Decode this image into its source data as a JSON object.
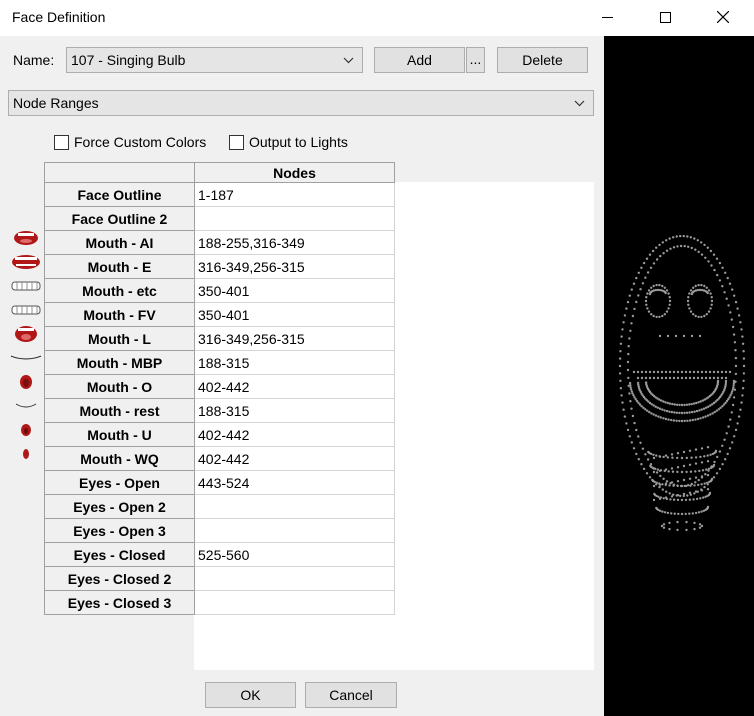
{
  "window": {
    "title": "Face Definition",
    "min_icon": "minimize-icon",
    "max_icon": "maximize-icon",
    "close_icon": "close-icon"
  },
  "name_row": {
    "label": "Name:",
    "selected": "107 - Singing Bulb",
    "add_label": "Add",
    "more_label": "...",
    "delete_label": "Delete"
  },
  "mode_combo": {
    "selected": "Node Ranges"
  },
  "options": {
    "force_custom_colors": {
      "label": "Force Custom Colors",
      "checked": false
    },
    "output_to_lights": {
      "label": "Output to Lights",
      "checked": false
    }
  },
  "grid": {
    "column_header": "Nodes",
    "rows": [
      {
        "name": "Face Outline",
        "nodes": "1-187",
        "icon": ""
      },
      {
        "name": "Face Outline 2",
        "nodes": "",
        "icon": ""
      },
      {
        "name": "Mouth - AI",
        "nodes": "188-255,316-349",
        "icon": "mouth-ai-icon"
      },
      {
        "name": "Mouth - E",
        "nodes": "316-349,256-315",
        "icon": "mouth-e-icon"
      },
      {
        "name": "Mouth - etc",
        "nodes": "350-401",
        "icon": "mouth-etc-icon"
      },
      {
        "name": "Mouth - FV",
        "nodes": "350-401",
        "icon": "mouth-fv-icon"
      },
      {
        "name": "Mouth - L",
        "nodes": "316-349,256-315",
        "icon": "mouth-l-icon"
      },
      {
        "name": "Mouth - MBP",
        "nodes": "188-315",
        "icon": "mouth-mbp-icon"
      },
      {
        "name": "Mouth - O",
        "nodes": "402-442",
        "icon": "mouth-o-icon"
      },
      {
        "name": "Mouth - rest",
        "nodes": "188-315",
        "icon": "mouth-rest-icon"
      },
      {
        "name": "Mouth - U",
        "nodes": "402-442",
        "icon": "mouth-u-icon"
      },
      {
        "name": "Mouth - WQ",
        "nodes": "402-442",
        "icon": "mouth-wq-icon"
      },
      {
        "name": "Eyes - Open",
        "nodes": "443-524",
        "icon": ""
      },
      {
        "name": "Eyes - Open 2",
        "nodes": "",
        "icon": ""
      },
      {
        "name": "Eyes - Open 3",
        "nodes": "",
        "icon": ""
      },
      {
        "name": "Eyes - Closed",
        "nodes": "525-560",
        "icon": ""
      },
      {
        "name": "Eyes - Closed 2",
        "nodes": "",
        "icon": ""
      },
      {
        "name": "Eyes - Closed 3",
        "nodes": "",
        "icon": ""
      }
    ]
  },
  "footer": {
    "ok_label": "OK",
    "cancel_label": "Cancel"
  },
  "colors": {
    "preview_background": "#000000",
    "preview_dots": "#9a9a9a",
    "mouth_red": "#b01818"
  }
}
